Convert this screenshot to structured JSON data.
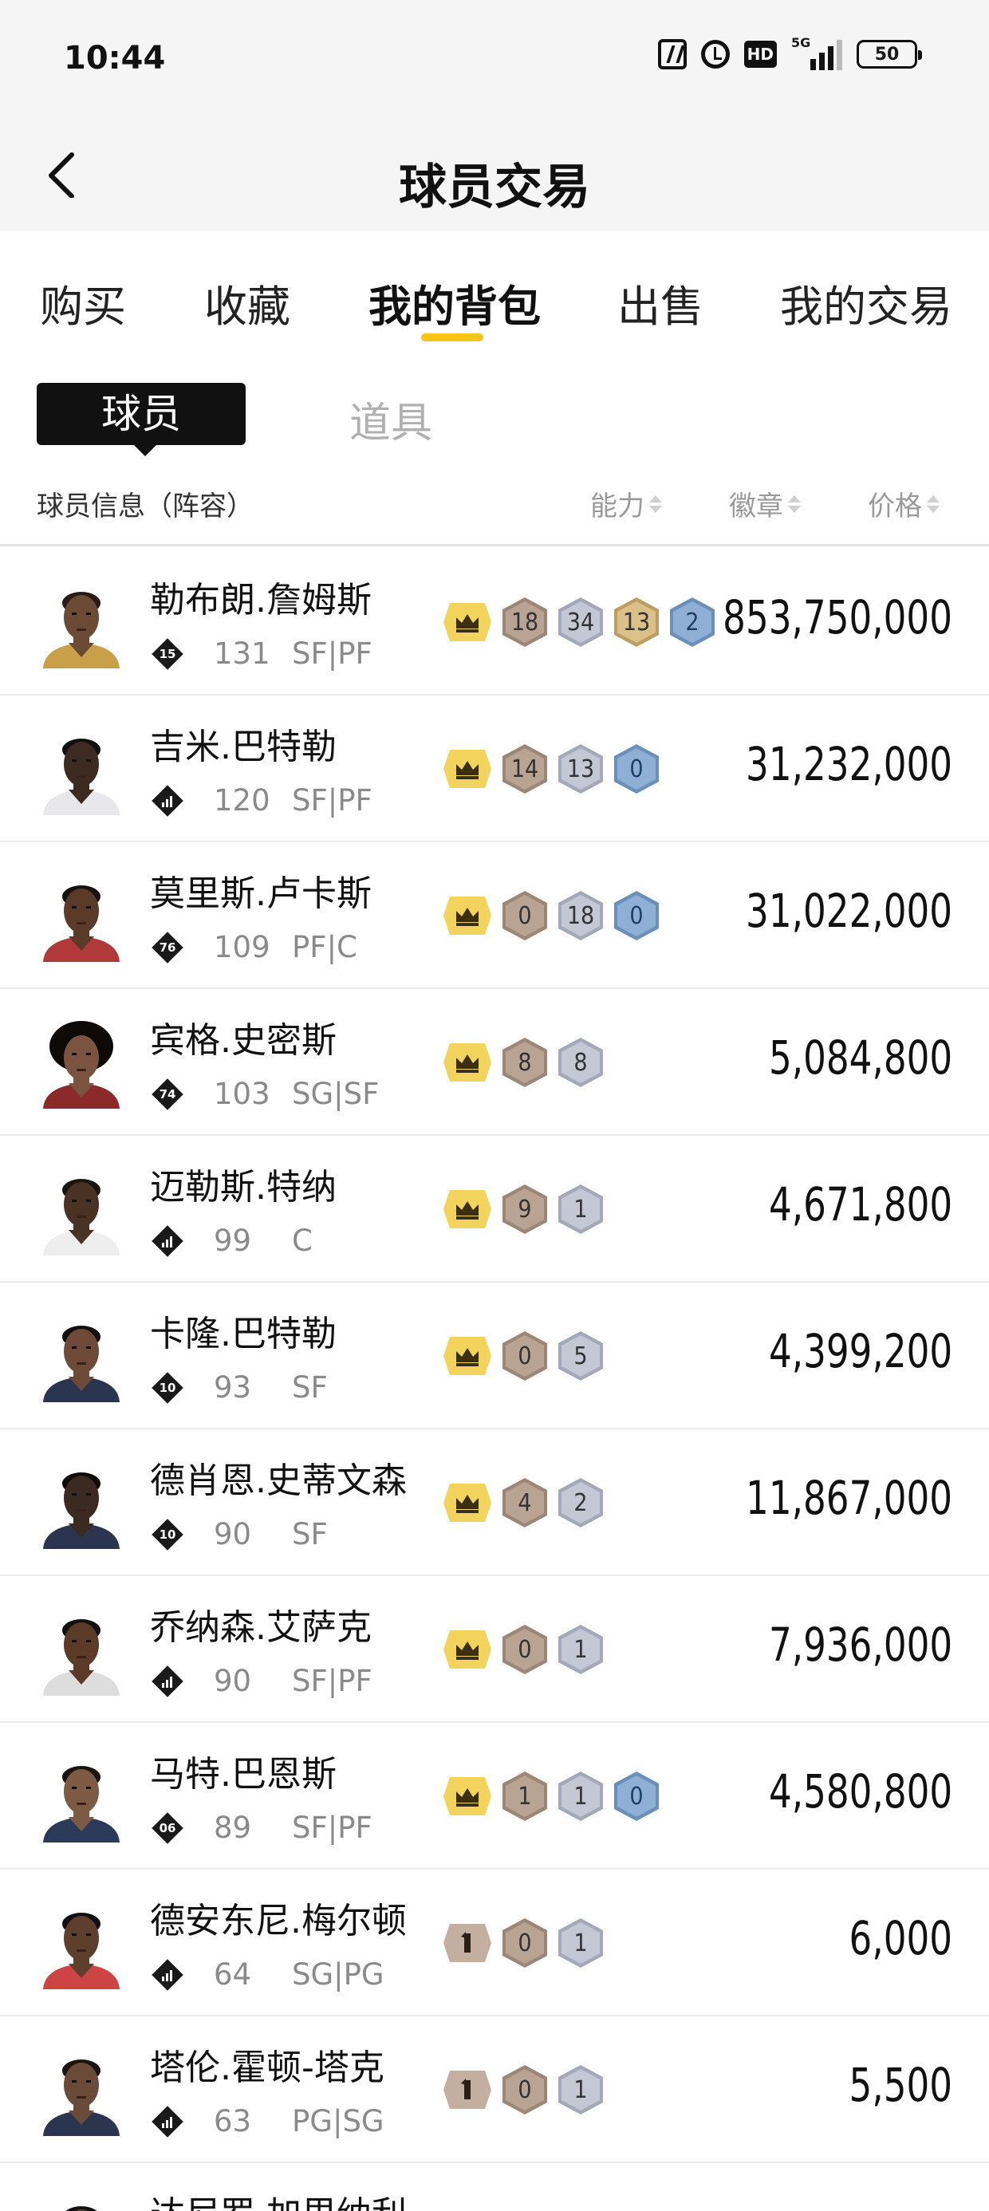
{
  "status_bar": {
    "time": "10:44",
    "network": "5G",
    "battery": "50",
    "icons": [
      "nfc-icon",
      "alarm-icon",
      "hd-icon",
      "signal-icon",
      "battery-icon"
    ]
  },
  "header": {
    "title": "球员交易",
    "back_icon": "chevron-left-icon"
  },
  "tabs": [
    {
      "label": "购买",
      "active": false
    },
    {
      "label": "收藏",
      "active": false
    },
    {
      "label": "我的背包",
      "active": true
    },
    {
      "label": "出售",
      "active": false
    },
    {
      "label": "我的交易",
      "active": false
    }
  ],
  "subtabs": {
    "active": "球员",
    "inactive": "道具"
  },
  "columns": {
    "info": "球员信息（阵容）",
    "ability": "能力",
    "badge": "徽章",
    "price": "价格"
  },
  "colors": {
    "accent": "#f5c518",
    "crown_bg": "#f2d45c",
    "bronze_hex": "#b9a494",
    "silver_hex": "#c3c8d4",
    "gold_hex": "#d8bd86",
    "blue_hex": "#8fb0d4"
  },
  "players": [
    {
      "name": "勒布朗.詹姆斯",
      "rank": "15",
      "rank_type": "number",
      "ovr": "131",
      "pos": "SF|PF",
      "first": "crown",
      "badges": [
        {
          "v": "18",
          "t": "bronze"
        },
        {
          "v": "34",
          "t": "silver"
        },
        {
          "v": "13",
          "t": "gold"
        },
        {
          "v": "2",
          "t": "blue"
        }
      ],
      "price": "853,750,000"
    },
    {
      "name": "吉米.巴特勒",
      "rank": "",
      "rank_type": "bars",
      "ovr": "120",
      "pos": "SF|PF",
      "first": "crown",
      "badges": [
        {
          "v": "14",
          "t": "bronze"
        },
        {
          "v": "13",
          "t": "silver"
        },
        {
          "v": "0",
          "t": "blue"
        }
      ],
      "price": "31,232,000"
    },
    {
      "name": "莫里斯.卢卡斯",
      "rank": "76",
      "rank_type": "number",
      "ovr": "109",
      "pos": "PF|C",
      "first": "crown",
      "badges": [
        {
          "v": "0",
          "t": "bronze"
        },
        {
          "v": "18",
          "t": "silver"
        },
        {
          "v": "0",
          "t": "blue"
        }
      ],
      "price": "31,022,000"
    },
    {
      "name": "宾格.史密斯",
      "rank": "74",
      "rank_type": "number",
      "ovr": "103",
      "pos": "SG|SF",
      "first": "crown",
      "badges": [
        {
          "v": "8",
          "t": "bronze"
        },
        {
          "v": "8",
          "t": "silver"
        }
      ],
      "price": "5,084,800"
    },
    {
      "name": "迈勒斯.特纳",
      "rank": "",
      "rank_type": "bars",
      "ovr": "99",
      "pos": "C",
      "first": "crown",
      "badges": [
        {
          "v": "9",
          "t": "bronze"
        },
        {
          "v": "1",
          "t": "silver"
        }
      ],
      "price": "4,671,800"
    },
    {
      "name": "卡隆.巴特勒",
      "rank": "10",
      "rank_type": "number",
      "ovr": "93",
      "pos": "SF",
      "first": "crown",
      "badges": [
        {
          "v": "0",
          "t": "bronze"
        },
        {
          "v": "5",
          "t": "silver"
        }
      ],
      "price": "4,399,200"
    },
    {
      "name": "德肖恩.史蒂文森",
      "rank": "10",
      "rank_type": "number",
      "ovr": "90",
      "pos": "SF",
      "first": "crown",
      "badges": [
        {
          "v": "4",
          "t": "bronze"
        },
        {
          "v": "2",
          "t": "silver"
        }
      ],
      "price": "11,867,000"
    },
    {
      "name": "乔纳森.艾萨克",
      "rank": "",
      "rank_type": "bars",
      "ovr": "90",
      "pos": "SF|PF",
      "first": "crown",
      "badges": [
        {
          "v": "0",
          "t": "bronze"
        },
        {
          "v": "1",
          "t": "silver"
        }
      ],
      "price": "7,936,000"
    },
    {
      "name": "马特.巴恩斯",
      "rank": "06",
      "rank_type": "number",
      "ovr": "89",
      "pos": "SF|PF",
      "first": "crown",
      "badges": [
        {
          "v": "1",
          "t": "bronze"
        },
        {
          "v": "1",
          "t": "silver"
        },
        {
          "v": "0",
          "t": "blue"
        }
      ],
      "price": "4,580,800"
    },
    {
      "name": "德安东尼.梅尔顿",
      "rank": "",
      "rank_type": "bars",
      "ovr": "64",
      "pos": "SG|PG",
      "first": "tier1",
      "badges": [
        {
          "v": "0",
          "t": "bronze"
        },
        {
          "v": "1",
          "t": "silver"
        }
      ],
      "price": "6,000"
    },
    {
      "name": "塔伦.霍顿-塔克",
      "rank": "",
      "rank_type": "bars",
      "ovr": "63",
      "pos": "PG|SG",
      "first": "tier1",
      "badges": [
        {
          "v": "0",
          "t": "bronze"
        },
        {
          "v": "1",
          "t": "silver"
        }
      ],
      "price": "5,500"
    },
    {
      "name": "达尼罗.加里纳利",
      "rank": "",
      "rank_type": "bars",
      "ovr": "",
      "pos": "",
      "first": "tier1",
      "badges": [
        {
          "v": "",
          "t": "bronze"
        },
        {
          "v": "",
          "t": "silver"
        }
      ],
      "price": ""
    }
  ]
}
